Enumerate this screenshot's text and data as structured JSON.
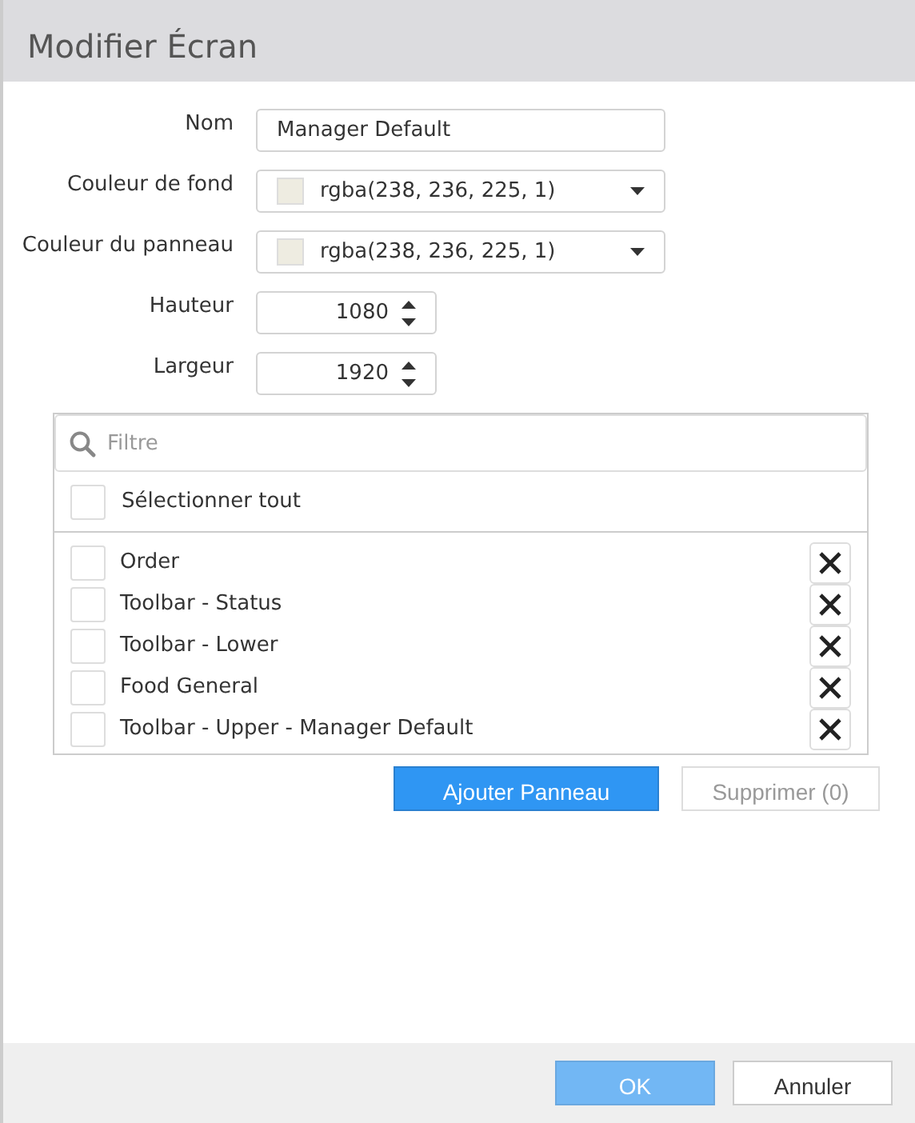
{
  "dialog": {
    "title": "Modifier Écran"
  },
  "fields": [
    {
      "kind": "text",
      "label": "Nom",
      "value": "Manager Default"
    },
    {
      "kind": "color",
      "label": "Couleur de fond",
      "value": "rgba(238, 236, 225, 1)",
      "color": "#eeece1"
    },
    {
      "kind": "color",
      "label": "Couleur du panneau",
      "value": "rgba(238, 236, 225, 1)",
      "color": "#eeece1"
    },
    {
      "kind": "number",
      "label": "Hauteur",
      "value": "1080"
    },
    {
      "kind": "number",
      "label": "Largeur",
      "value": "1920"
    }
  ],
  "panel_list": {
    "filter": {
      "placeholder": "Filtre"
    },
    "select_all": {
      "label": "Sélectionner tout",
      "checked": false
    },
    "items": [
      {
        "label": "Order",
        "checked": false
      },
      {
        "label": "Toolbar - Status",
        "checked": false
      },
      {
        "label": "Toolbar - Lower",
        "checked": false
      },
      {
        "label": "Food General",
        "checked": false
      },
      {
        "label": "Toolbar - Upper - Manager Default",
        "checked": false
      }
    ]
  },
  "list_buttons": [
    {
      "kind": "primary",
      "label": "Ajouter Panneau",
      "disabled": false
    },
    {
      "kind": "secondary",
      "label": "Supprimer (0)",
      "disabled": true
    }
  ],
  "footer_buttons": [
    {
      "kind": "primary",
      "label": "OK",
      "disabled": true
    },
    {
      "kind": "secondary",
      "label": "Annuler",
      "disabled": false
    }
  ]
}
